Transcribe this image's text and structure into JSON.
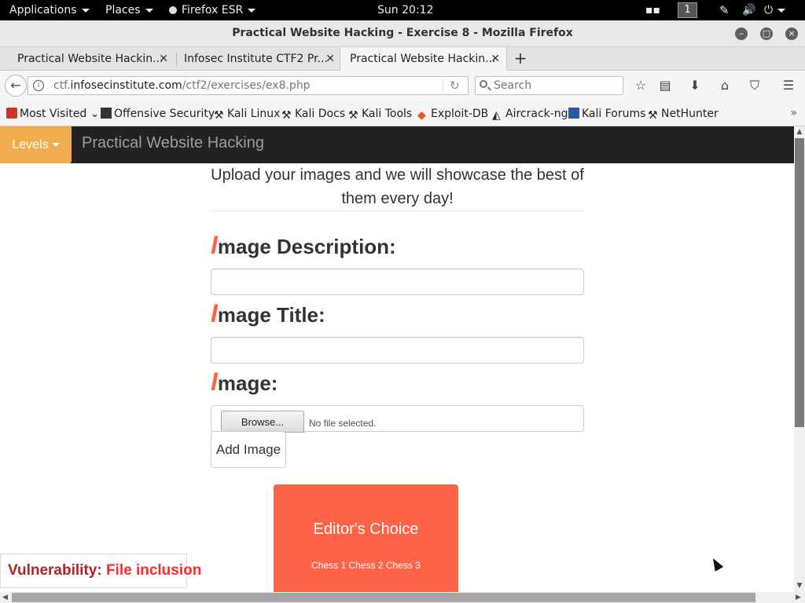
{
  "topbar": {
    "applications": "Applications",
    "places": "Places",
    "firefox": "Firefox ESR",
    "clock": "Sun 20:12",
    "workspace": "1"
  },
  "window": {
    "title": "Practical Website Hacking - Exercise 8 - Mozilla Firefox"
  },
  "tabs": [
    {
      "label": "Practical Website Hackin..."
    },
    {
      "label": "Infosec Institute CTF2 Pr..."
    },
    {
      "label": "Practical Website Hackin..."
    }
  ],
  "nav": {
    "url_prefix": "ctf.",
    "url_domain": "infosecinstitute.com",
    "url_path": "/ctf2/exercises/ex8.php",
    "search_placeholder": "Search"
  },
  "bookmarks": [
    {
      "label": "Most Visited"
    },
    {
      "label": "Offensive Security"
    },
    {
      "label": "Kali Linux"
    },
    {
      "label": "Kali Docs"
    },
    {
      "label": "Kali Tools"
    },
    {
      "label": "Exploit-DB"
    },
    {
      "label": "Aircrack-ng"
    },
    {
      "label": "Kali Forums"
    },
    {
      "label": "NetHunter"
    }
  ],
  "site": {
    "levels": "Levels",
    "brand": "Practical Website Hacking",
    "intro": "Upload your images and we will showcase the best of them every day!",
    "desc_cap": "I",
    "desc_rest": "mage Description:",
    "title_cap": "I",
    "title_rest": "mage Title:",
    "image_cap": "I",
    "image_rest": "mage:",
    "browse": "Browse...",
    "no_file": "No file selected.",
    "add_image": "Add Image",
    "editor_heading": "Editor's Choice",
    "editor_items": "Chess 1 Chess 2 Chess 3",
    "vuln_label": "Vulnerability:",
    "vuln_value": "File inclusion"
  },
  "colors": {
    "accent": "#ff6347",
    "levels": "#f0ad4e",
    "navbar": "#222222"
  }
}
